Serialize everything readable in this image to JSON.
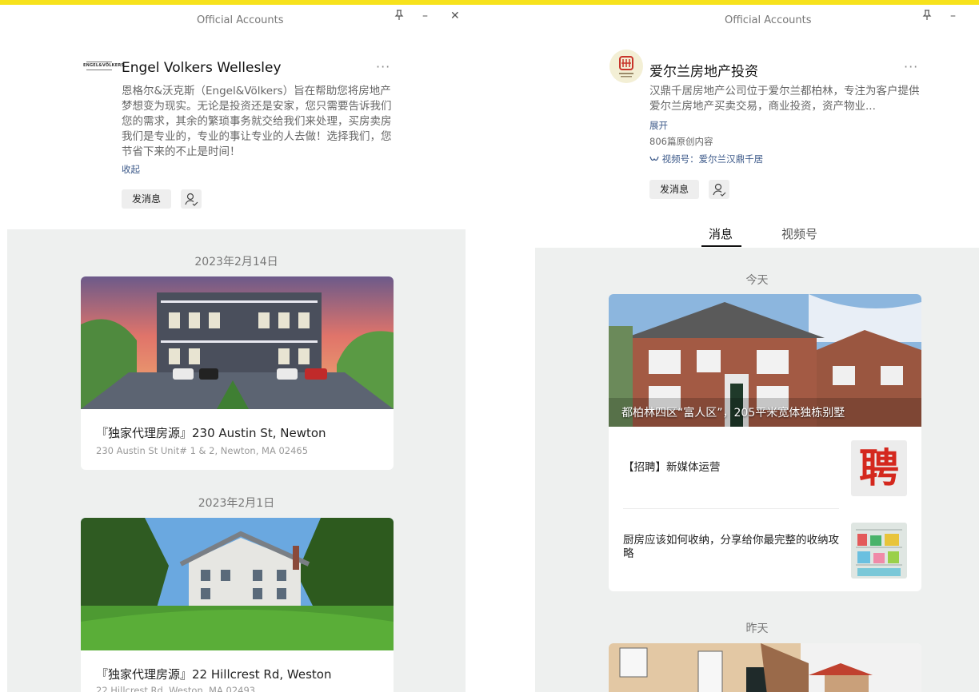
{
  "colors": {
    "accent_strip": "#f7e21c",
    "link": "#3d5a8a",
    "feed_bg": "#eef0ef"
  },
  "left": {
    "window_title": "Official Accounts",
    "controls": {
      "pin": "⊥",
      "minimize": "–",
      "close": "✕"
    },
    "account": {
      "logo_text_top": "ENGEL&VÖLKERS",
      "name": "Engel Volkers Wellesley",
      "more": "···",
      "description": "恩格尔&沃克斯（Engel&Völkers）旨在帮助您将房地产梦想变为现实。无论是投资还是安家，您只需要告诉我们您的需求，其余的繁琐事务就交给我们来处理，买房卖房我们是专业的，专业的事让专业的人去做！选择我们，您节省下来的不止是时间！",
      "collapse_link": "收起",
      "send_message": "发消息"
    },
    "feed": [
      {
        "date": "2023年2月14日",
        "title": "『独家代理房源』230 Austin St, Newton",
        "subtitle": "230 Austin St Unit# 1 & 2, Newton, MA 02465"
      },
      {
        "date": "2023年2月1日",
        "title": "『独家代理房源』22 Hillcrest Rd, Weston",
        "subtitle": "22 Hillcrest Rd, Weston, MA 02493"
      }
    ]
  },
  "right": {
    "window_title": "Official Accounts",
    "controls": {
      "pin": "⊥",
      "minimize": "–"
    },
    "account": {
      "name": "爱尔兰房地产投资",
      "more": "···",
      "description": "汉鼎千居房地产公司位于爱尔兰都柏林，专注为客户提供爱尔兰房地产买卖交易，商业投资，资产物业...",
      "expand_link": "展开",
      "original_count": "806篇原创内容",
      "channel_link": "视频号：爱尔兰汉鼎千居",
      "send_message": "发消息"
    },
    "tabs": [
      {
        "label": "消息",
        "active": true
      },
      {
        "label": "视频号",
        "active": false
      }
    ],
    "feed": {
      "today_label": "今天",
      "hero_caption": "都柏林四区“富人区”，205平米宽体独栋别墅",
      "items": [
        {
          "text": "【招聘】新媒体运营",
          "thumb": "聘"
        },
        {
          "text": "厨房应该如何收纳，分享给你最完整的收纳攻略"
        }
      ],
      "yesterday_label": "昨天"
    }
  }
}
